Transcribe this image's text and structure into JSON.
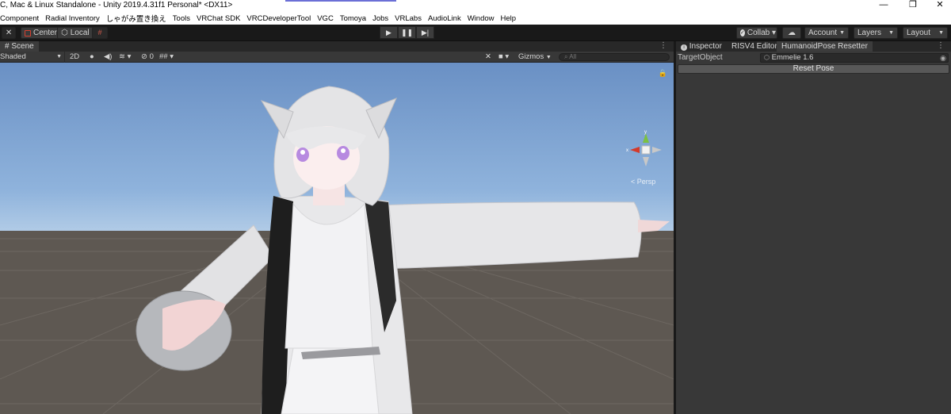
{
  "window": {
    "title": "C, Mac & Linux Standalone - Unity 2019.4.31f1 Personal* <DX11>",
    "controls": {
      "minimize": "—",
      "restore": "❐",
      "close": "✕"
    }
  },
  "menu": [
    "Component",
    "Radial Inventory",
    "しゃがみ置き換え",
    "Tools",
    "VRChat SDK",
    "VRCDeveloperTool",
    "VGC",
    "Tomoya",
    "Jobs",
    "VRLabs",
    "AudioLink",
    "Window",
    "Help"
  ],
  "toolbar": {
    "pivot": "Center",
    "space": "Local",
    "collab": "Collab ▾",
    "account": "Account",
    "layers": "Layers",
    "layout": "Layout"
  },
  "scene": {
    "tab": "Scene",
    "shading": "Shaded",
    "mode_2d": "2D",
    "hidden_count": "0",
    "gizmos": "Gizmos",
    "search_placeholder": "All",
    "persp": "< Persp",
    "axis_y": "y",
    "axis_x": "x"
  },
  "inspector": {
    "tabs": [
      "Inspector",
      "RISV4 Editor",
      "HumanoidPose Resetter"
    ],
    "active_tab": 2,
    "field_label": "TargetObject",
    "field_value": "Emmelie 1.6",
    "button": "Reset Pose"
  },
  "colors": {
    "editor_bg": "#383838",
    "toolbar_bg": "#191919",
    "sky": "#8fb3dc",
    "ground": "#5e5852",
    "gizmo_x": "#d43a2a",
    "gizmo_y": "#7bc043"
  }
}
